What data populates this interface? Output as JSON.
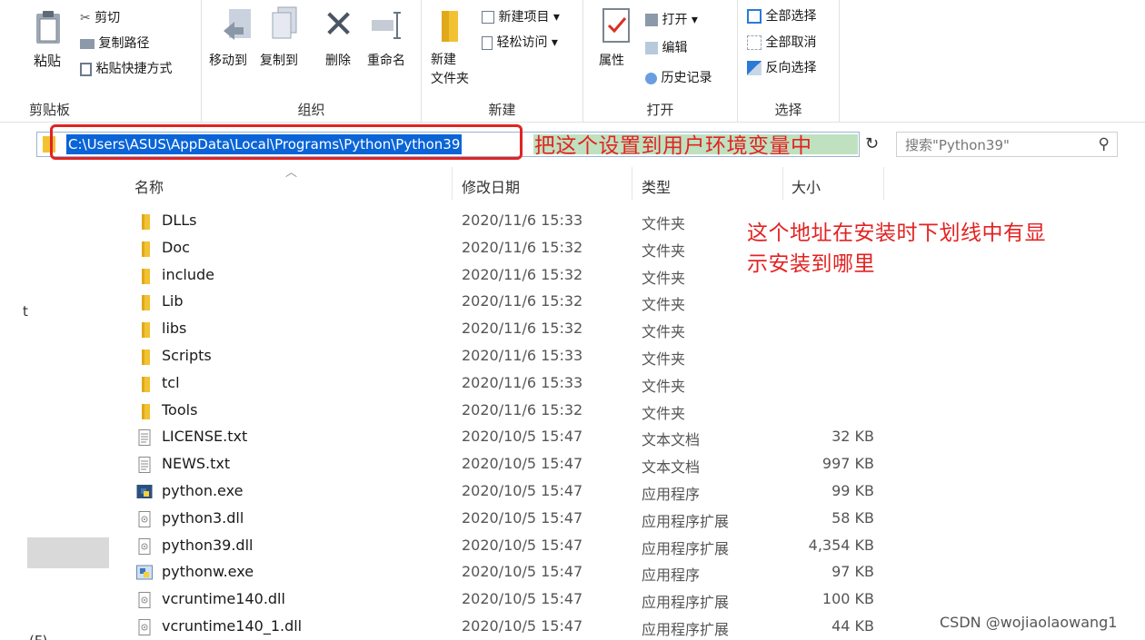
{
  "ribbon": {
    "clipboard": {
      "paste": "粘贴",
      "cut": "剪切",
      "copy_path": "复制路径",
      "paste_shortcut": "粘贴快捷方式",
      "label": "剪贴板"
    },
    "organize": {
      "move_to": "移动到",
      "copy_to": "复制到",
      "delete": "删除",
      "rename": "重命名",
      "label": "组织"
    },
    "new": {
      "new_folder_line1": "新建",
      "new_folder_line2": "文件夹",
      "new_item": "新建项目 ▾",
      "easy_access": "轻松访问 ▾",
      "label": "新建"
    },
    "open": {
      "properties": "属性",
      "open": "打开 ▾",
      "edit": "编辑",
      "history": "历史记录",
      "label": "打开"
    },
    "select": {
      "select_all": "全部选择",
      "select_none": "全部取消",
      "invert": "反向选择",
      "label": "选择"
    }
  },
  "address": {
    "path": "C:\\Users\\ASUS\\AppData\\Local\\Programs\\Python\\Python39",
    "search_placeholder": "搜索\"Python39\""
  },
  "annotations": {
    "set_env": "把这个设置到用户环境变量中",
    "install_note_line1": "这个地址在安装时下划线中有显",
    "install_note_line2": "示安装到哪里"
  },
  "columns": {
    "name": "名称",
    "date": "修改日期",
    "type": "类型",
    "size": "大小"
  },
  "files": [
    {
      "name": "DLLs",
      "date": "2020/11/6 15:33",
      "type": "文件夹",
      "size": "",
      "icon": "folder-icon"
    },
    {
      "name": "Doc",
      "date": "2020/11/6 15:32",
      "type": "文件夹",
      "size": "",
      "icon": "folder-icon"
    },
    {
      "name": "include",
      "date": "2020/11/6 15:32",
      "type": "文件夹",
      "size": "",
      "icon": "folder-icon"
    },
    {
      "name": "Lib",
      "date": "2020/11/6 15:32",
      "type": "文件夹",
      "size": "",
      "icon": "folder-icon"
    },
    {
      "name": "libs",
      "date": "2020/11/6 15:32",
      "type": "文件夹",
      "size": "",
      "icon": "folder-icon"
    },
    {
      "name": "Scripts",
      "date": "2020/11/6 15:33",
      "type": "文件夹",
      "size": "",
      "icon": "folder-icon"
    },
    {
      "name": "tcl",
      "date": "2020/11/6 15:33",
      "type": "文件夹",
      "size": "",
      "icon": "folder-icon"
    },
    {
      "name": "Tools",
      "date": "2020/11/6 15:32",
      "type": "文件夹",
      "size": "",
      "icon": "folder-icon"
    },
    {
      "name": "LICENSE.txt",
      "date": "2020/10/5 15:47",
      "type": "文本文档",
      "size": "32 KB",
      "icon": "text-file-icon"
    },
    {
      "name": "NEWS.txt",
      "date": "2020/10/5 15:47",
      "type": "文本文档",
      "size": "997 KB",
      "icon": "text-file-icon"
    },
    {
      "name": "python.exe",
      "date": "2020/10/5 15:47",
      "type": "应用程序",
      "size": "99 KB",
      "icon": "python-exe-icon"
    },
    {
      "name": "python3.dll",
      "date": "2020/10/5 15:47",
      "type": "应用程序扩展",
      "size": "58 KB",
      "icon": "dll-file-icon"
    },
    {
      "name": "python39.dll",
      "date": "2020/10/5 15:47",
      "type": "应用程序扩展",
      "size": "4,354 KB",
      "icon": "dll-file-icon"
    },
    {
      "name": "pythonw.exe",
      "date": "2020/10/5 15:47",
      "type": "应用程序",
      "size": "97 KB",
      "icon": "pythonw-exe-icon"
    },
    {
      "name": "vcruntime140.dll",
      "date": "2020/10/5 15:47",
      "type": "应用程序扩展",
      "size": "100 KB",
      "icon": "dll-file-icon"
    },
    {
      "name": "vcruntime140_1.dll",
      "date": "2020/10/5 15:47",
      "type": "应用程序扩展",
      "size": "44 KB",
      "icon": "dll-file-icon"
    }
  ],
  "nav": {
    "fragment1": "t",
    "fragment2": "(F)"
  },
  "watermark": "CSDN @wojiaolaowang1",
  "colors": {
    "annotation_red": "#e32222",
    "selection_blue": "#0a64d7",
    "folder_yellow": "#f2c233"
  }
}
